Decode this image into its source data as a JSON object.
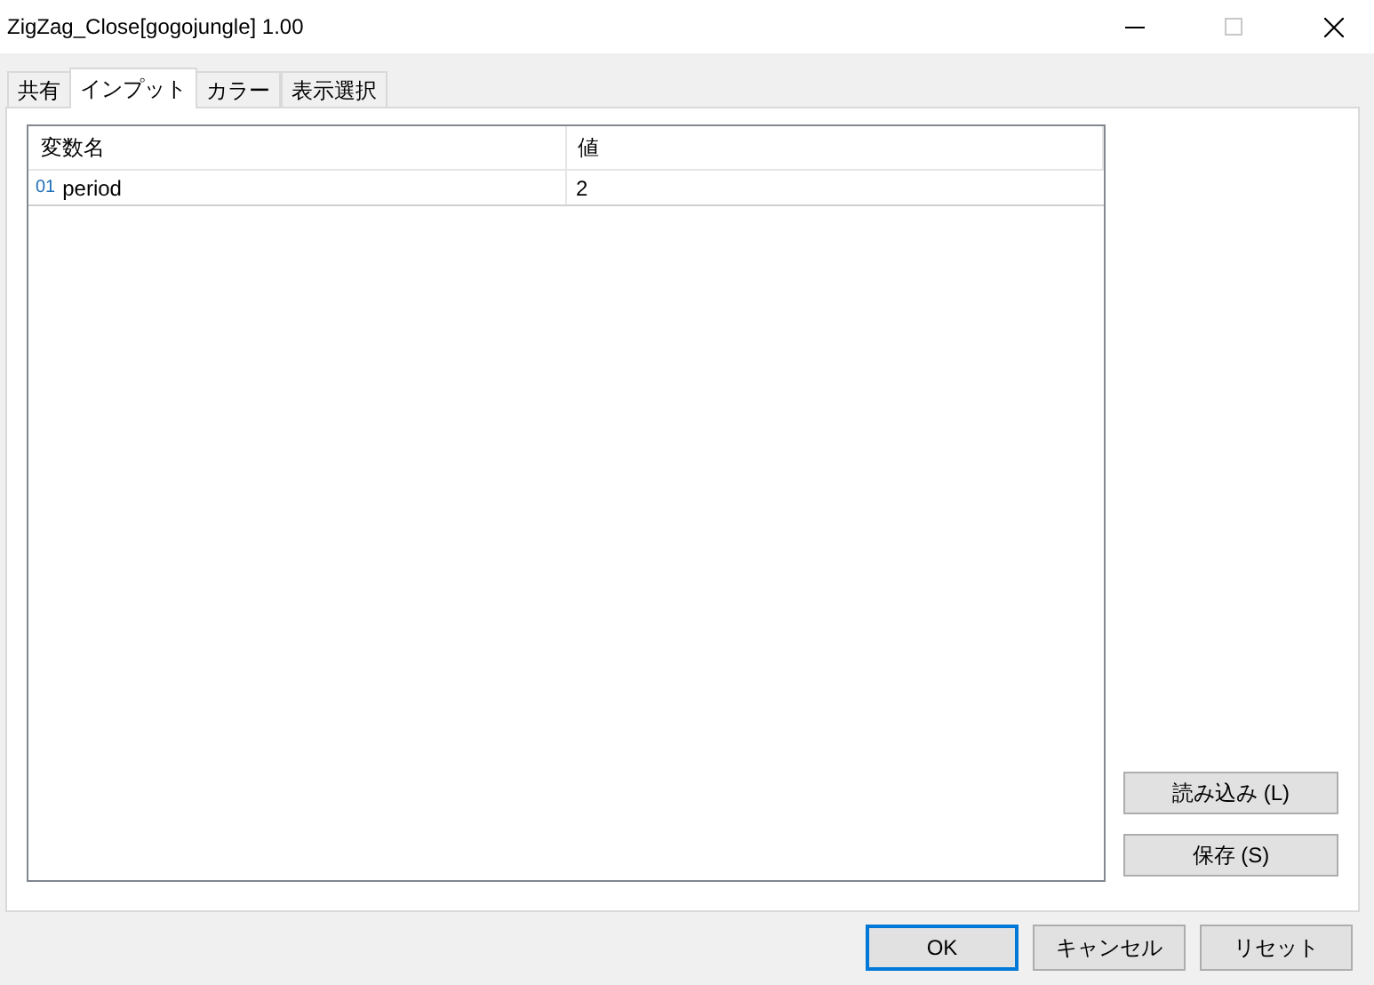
{
  "window": {
    "title": "ZigZag_Close[gogojungle] 1.00"
  },
  "tabs": [
    {
      "label": "共有",
      "selected": false
    },
    {
      "label": "インプット",
      "selected": true
    },
    {
      "label": "カラー",
      "selected": false
    },
    {
      "label": "表示選択",
      "selected": false
    }
  ],
  "table": {
    "columns": [
      "変数名",
      "値"
    ],
    "rows": [
      {
        "type_label": "01",
        "name": "period",
        "value": "2"
      }
    ]
  },
  "side_buttons": [
    "読み込み (L)",
    "保存 (S)"
  ],
  "buttons": [
    {
      "label": "OK",
      "default": true
    },
    {
      "label": "キャンセル",
      "default": false
    },
    {
      "label": "リセット",
      "default": false
    }
  ]
}
